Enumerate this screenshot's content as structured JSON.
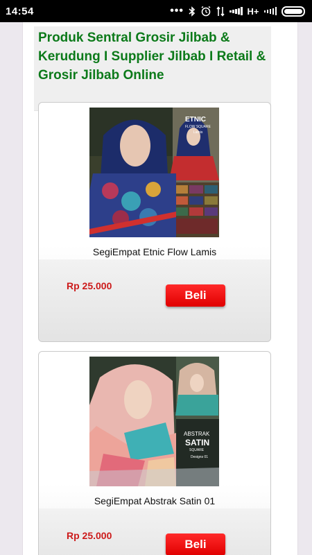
{
  "status_bar": {
    "time": "14:54",
    "network_type": "H+",
    "icons": [
      "more-dots-icon",
      "bluetooth-icon",
      "alarm-icon",
      "data-transfer-icon",
      "signal-icon",
      "signal-icon",
      "battery-icon"
    ]
  },
  "header": {
    "title": "Produk Sentral Grosir Jilbab & Kerudung I Supplier Jilbab I Retail & Grosir Jilbab Online"
  },
  "products": [
    {
      "name": "SegiEmpat Etnic Flow Lamis",
      "price": "Rp 25.000",
      "buy_label": "Beli",
      "image_text": [
        "ETNIC",
        "FLOW SQUARE",
        "Lamis"
      ]
    },
    {
      "name": "SegiEmpat Abstrak Satin 01",
      "price": "Rp 25.000",
      "buy_label": "Beli",
      "image_text": [
        "ABSTRAK",
        "SATIN",
        "SQUARE",
        "Designs 01"
      ]
    }
  ],
  "colors": {
    "title_green": "#0c7a1a",
    "price_red": "#cc1a1a",
    "button_red": "#e00000"
  }
}
